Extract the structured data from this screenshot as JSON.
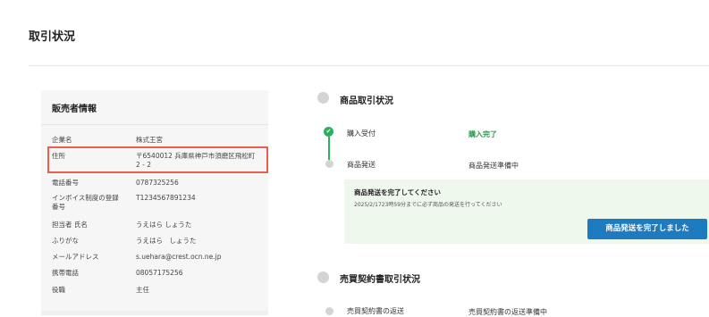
{
  "page": {
    "title": "取引状況"
  },
  "seller": {
    "title": "販売者情報",
    "rows": [
      {
        "label": "企業名",
        "value": "株式王宮"
      },
      {
        "label": "住所",
        "value": "〒6540012 兵庫県神戸市須磨区飛松町 2 - 2"
      },
      {
        "label": "電話番号",
        "value": "0787325256"
      },
      {
        "label": "インボイス制度の登録番号",
        "value": "T1234567891234"
      },
      {
        "label": "担当者 氏名",
        "value": "うえはら しょうた"
      },
      {
        "label": "ふりがな",
        "value": "うえはら　しょうた"
      },
      {
        "label": "メールアドレス",
        "value": "s.uehara@crest.ocn.ne.jp"
      },
      {
        "label": "携帯電話",
        "value": "08057175256"
      },
      {
        "label": "役職",
        "value": "主任"
      }
    ]
  },
  "product": {
    "title": "商品取引状況",
    "steps": [
      {
        "label": "購入受付",
        "status": "購入完了"
      },
      {
        "label": "商品発送",
        "status": "商品発送準備中"
      }
    ],
    "notice": {
      "title": "商品発送を完了してください",
      "desc": "2025/2/1723時59分までに必ず商品の発送を行ってください",
      "button": "商品発送を完了しました"
    }
  },
  "contract": {
    "title": "売買契約書取引状況",
    "steps": [
      {
        "label": "売買契約書の返送",
        "status": "売買契約書の返送準備中"
      }
    ]
  },
  "colors": {
    "accent": "#1f7bc0",
    "success": "#2bb15a",
    "highlight": "#e8604c"
  }
}
